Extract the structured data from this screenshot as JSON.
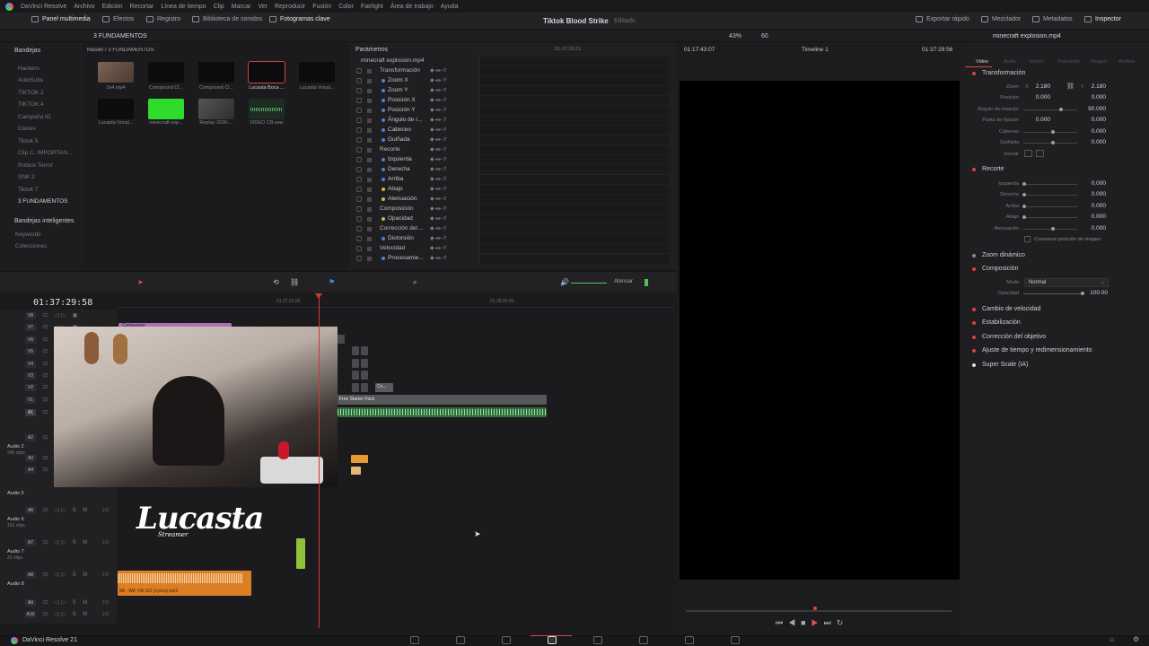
{
  "menu": [
    "DaVinci Resolve",
    "Archivo",
    "Edición",
    "Recortar",
    "Línea de tiempo",
    "Clip",
    "Marcar",
    "Ver",
    "Reproducir",
    "Fusión",
    "Color",
    "Fairlight",
    "Área de trabajo",
    "Ayuda"
  ],
  "toolbar": {
    "media_pool": "Panel multimedia",
    "effects": "Efectos",
    "index": "Registro",
    "sound_library": "Biblioteca de sonidos",
    "keyframes": "Fotogramas clave",
    "project_title": "Tiktok Blood Strike",
    "project_status": "Editado",
    "quick_export": "Exportar rápido",
    "mixer": "Mezclador",
    "metadata": "Metadatos",
    "inspector": "Inspector"
  },
  "bins": {
    "header": "Bandejas",
    "path": "3 FUNDAMENTOS",
    "breadcrumb": "Master / 3 FUNDAMENTOS",
    "items": [
      "Hackers",
      "AutoSubs",
      "TIKTOK 2",
      "TIKTOK 4",
      "Campaña IG",
      "Clases",
      "Tiktok 5",
      "Clip C. IMPORTAN...",
      "Roblox Terror",
      "SNK 2",
      "Tiktok 7",
      "3 FUNDAMENTOS"
    ],
    "smart_header": "Bandejas inteligentes",
    "smart_items": [
      "Keywords",
      "Colecciones"
    ]
  },
  "media": {
    "clips": [
      {
        "name": "2x4.mp4",
        "color": "#6b5a4e"
      },
      {
        "name": "Compound Cl...",
        "color": "#0d0d0e"
      },
      {
        "name": "Compound Cl...",
        "color": "#0d0d0e"
      },
      {
        "name": "Lucasta Boca ...",
        "color": "#0d0d0e"
      },
      {
        "name": "Lucasta Vocal...",
        "color": "#0d0d0e"
      },
      {
        "name": "Lucasta Vocal...",
        "color": "#0d0d0e"
      },
      {
        "name": "minecraft exp...",
        "color": "#2fdc2b"
      },
      {
        "name": "Replay 2026-...",
        "color": "#4c4c4c"
      },
      {
        "name": "VIDEO CB.wav",
        "color": "#2a2a2c"
      }
    ]
  },
  "params": {
    "header": "Parámetros",
    "clip": "minecraft explosion.mp4",
    "timecode_a": "01:37:26:21",
    "rows": [
      {
        "label": "Transformación",
        "cat": true
      },
      {
        "label": "Zoom X",
        "color": "b"
      },
      {
        "label": "Zoom Y",
        "color": "b"
      },
      {
        "label": "Posición X",
        "color": "b"
      },
      {
        "label": "Posición Y",
        "color": "b"
      },
      {
        "label": "Ángulo de r...",
        "color": "b"
      },
      {
        "label": "Cabeceo",
        "color": "b"
      },
      {
        "label": "Guiñada",
        "color": "b"
      },
      {
        "label": "Recorte",
        "cat": true
      },
      {
        "label": "Izquierda",
        "color": "b"
      },
      {
        "label": "Derecha",
        "color": "b"
      },
      {
        "label": "Arriba",
        "color": "b"
      },
      {
        "label": "Abajo",
        "color": "y"
      },
      {
        "label": "Atenuación",
        "color": "y"
      },
      {
        "label": "Composición",
        "cat": true
      },
      {
        "label": "Opacidad",
        "color": "y"
      },
      {
        "label": "Corrección del ...",
        "cat": true
      },
      {
        "label": "Distorsión",
        "color": "b"
      },
      {
        "label": "Velocidad",
        "cat": true
      },
      {
        "label": "Procesamie...",
        "color": "b"
      }
    ]
  },
  "viewer": {
    "zoom": "43%",
    "fps": "60",
    "source_tc": "01:17:43:07",
    "timeline_name": "Timeline 1",
    "record_tc": "01:37:29:56"
  },
  "inspector": {
    "clip": "minecraft explosion.mp4",
    "tabs": [
      "Video",
      "Audio",
      "Efecto",
      "Transición",
      "Imagen",
      "Archivo"
    ],
    "transform": {
      "title": "Transformación",
      "zoom_label": "Zoom",
      "zoom_x": "2.180",
      "zoom_y": "2.180",
      "position_label": "Posición",
      "pos_x": "0.000",
      "pos_y": "0.000",
      "rotation_label": "Ángulo de rotación",
      "rotation": "90.000",
      "pivot_label": "Punto de fijación",
      "pivot_x": "0.000",
      "pivot_y": "0.000",
      "pitch_label": "Cabeceo",
      "pitch": "0.000",
      "yaw_label": "Guiñada",
      "yaw": "0.000",
      "flip_label": "Invertir"
    },
    "crop": {
      "title": "Recorte",
      "left_label": "Izquierda",
      "left": "0.000",
      "right_label": "Derecha",
      "right": "0.000",
      "top_label": "Arriba",
      "top": "0.000",
      "bottom_label": "Abajo",
      "bottom": "0.000",
      "soft_label": "Atenuación",
      "soft": "0.000",
      "retain": "Conservar posición de imagen"
    },
    "dynamic_zoom": "Zoom dinámico",
    "composite": {
      "title": "Composición",
      "mode_label": "Modo",
      "mode": "Normal",
      "opacity_label": "Opacidad",
      "opacity": "100.00"
    },
    "sections": [
      "Cambio de velocidad",
      "Estabilización",
      "Corrección del objetivo",
      "Ajuste de tiempo y redimensionamiento",
      "Super Scale (IA)"
    ]
  },
  "timeline": {
    "timecode": "01:37:29:58",
    "ruler": [
      "01:37:22:00",
      "01:38:00:00"
    ],
    "attenuate": "Atenuar",
    "video_tracks": [
      "V8",
      "V7",
      "V6",
      "V5",
      "V4",
      "V3",
      "V2",
      "V1"
    ],
    "audio_tracks": [
      {
        "tag": "A1"
      },
      {
        "tag": "A2",
        "name": "Audio 2",
        "clips": "246 clips"
      },
      {
        "tag": "A3"
      },
      {
        "tag": "A4"
      },
      {
        "tag": "A5",
        "name": "Audio 5"
      },
      {
        "tag": "A6",
        "name": "Audio 6",
        "clips": "151 clips",
        "ch": "2.0"
      },
      {
        "tag": "A7",
        "name": "Audio 7",
        "clips": "31 clips",
        "ch": "2.0"
      },
      {
        "tag": "A8",
        "name": "Audio 8",
        "ch": "2.0"
      },
      {
        "tag": "A9",
        "ch": "2.0"
      },
      {
        "tag": "A10",
        "ch": "2.0"
      }
    ],
    "clip_video_label": "Free Starter Pack",
    "clip_small_label": "Co...",
    "clip_compound": "Compuesto",
    "audio_clip_label": "8A - WE ON GO (Lyrics).mp3",
    "logo_text": "Lucasta",
    "logo_sub": "Streamer"
  },
  "footer": {
    "app": "DaVinci Resolve 21"
  }
}
